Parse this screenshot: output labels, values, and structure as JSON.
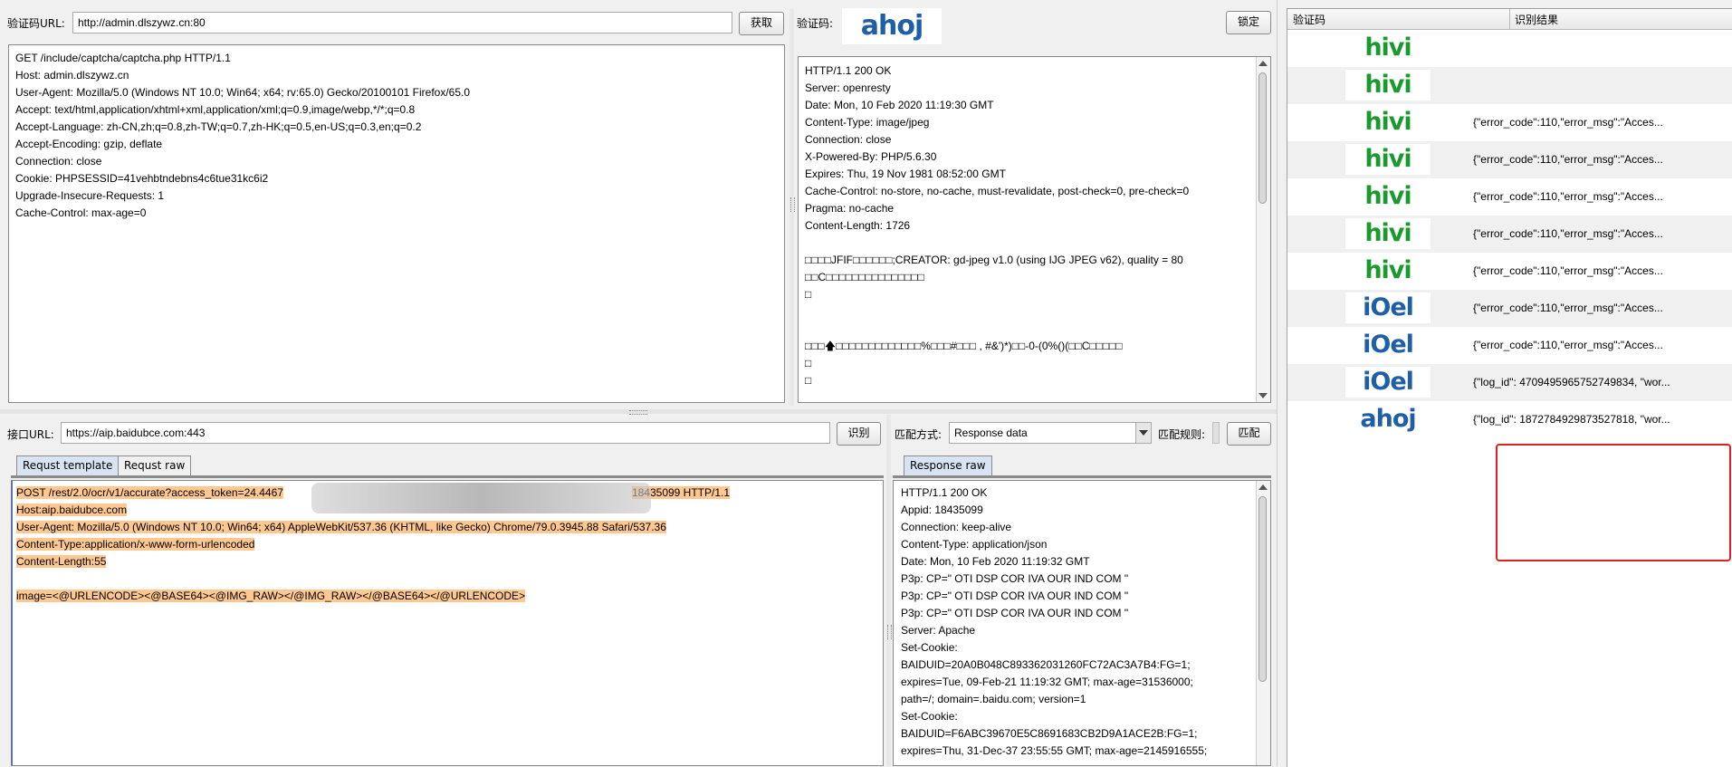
{
  "captcha_url": {
    "label": "验证码URL:",
    "value": "http://admin.dlszywz.cn:80",
    "fetch_button": "获取"
  },
  "captcha_preview": {
    "label": "验证码:",
    "image_text": "ahoj",
    "lock_button": "锁定"
  },
  "request_raw": [
    "GET /include/captcha/captcha.php HTTP/1.1",
    "Host: admin.dlszywz.cn",
    "User-Agent: Mozilla/5.0 (Windows NT 10.0; Win64; x64; rv:65.0) Gecko/20100101 Firefox/65.0",
    "Accept: text/html,application/xhtml+xml,application/xml;q=0.9,image/webp,*/*;q=0.8",
    "Accept-Language: zh-CN,zh;q=0.8,zh-TW;q=0.7,zh-HK;q=0.5,en-US;q=0.3,en;q=0.2",
    "Accept-Encoding: gzip, deflate",
    "Connection: close",
    "Cookie: PHPSESSID=41vehbtndebns4c6tue31kc6i2",
    "Upgrade-Insecure-Requests: 1",
    "Cache-Control: max-age=0"
  ],
  "response_raw": [
    "HTTP/1.1 200 OK",
    "Server: openresty",
    "Date: Mon, 10 Feb 2020 11:19:30 GMT",
    "Content-Type: image/jpeg",
    "Connection: close",
    "X-Powered-By: PHP/5.6.30",
    "Expires: Thu, 19 Nov 1981 08:52:00 GMT",
    "Cache-Control: no-store, no-cache, must-revalidate, post-check=0, pre-check=0",
    "Pragma: no-cache",
    "Content-Length: 1726",
    "",
    "□□□□JFIF□□□□□□;CREATOR: gd-jpeg v1.0 (using IJG JPEG v62), quality = 80",
    "□□C□□□□□□□□□□□□□□□",
    "□",
    "",
    "",
    "□□□🡅□□□□□□□□□□□□□%□□□#□□□ , #&')*)□□-0-(0%()(□□C□□□□□",
    "□",
    "□"
  ],
  "api_url": {
    "label": "接口URL:",
    "value": "https://aip.baidubce.com:443",
    "recognize_button": "识别"
  },
  "match": {
    "mode_label": "匹配方式:",
    "mode_value": "Response data",
    "rule_label": "匹配规则:",
    "match_button": "匹配"
  },
  "request_tabs": [
    "Requst template",
    "Requst raw"
  ],
  "request_template": [
    "POST /rest/2.0/ocr/v1/accurate?access_token=24.4467",
    "Host:aip.baidubce.com",
    "User-Agent: Mozilla/5.0 (Windows NT 10.0; Win64; x64) AppleWebKit/537.36 (KHTML, like Gecko) Chrome/79.0.3945.88 Safari/537.36",
    "Content-Type:application/x-www-form-urlencoded",
    "Content-Length:55",
    "",
    "image=<@URLENCODE><@BASE64><@IMG_RAW></@IMG_RAW></@BASE64></@URLENCODE>"
  ],
  "request_template_line1_tail": "18435099 HTTP/1.1",
  "response_tab": "Response raw",
  "api_response": [
    "HTTP/1.1 200 OK",
    "Appid: 18435099",
    "Connection: keep-alive",
    "Content-Type: application/json",
    "Date: Mon, 10 Feb 2020 11:19:32 GMT",
    "P3p: CP=\" OTI DSP COR IVA OUR IND COM \"",
    "P3p: CP=\" OTI DSP COR IVA OUR IND COM \"",
    "P3p: CP=\" OTI DSP COR IVA OUR IND COM \"",
    "Server: Apache",
    "Set-Cookie:",
    "BAIDUID=20A0B048C893362031260FC72AC3A7B4:FG=1;",
    "expires=Tue, 09-Feb-21 11:19:32 GMT; max-age=31536000;",
    "path=/; domain=.baidu.com; version=1",
    "Set-Cookie:",
    "BAIDUID=F6ABC39670E5C8691683CB2D9A1ACE2B:FG=1;",
    "expires=Thu, 31-Dec-37 23:55:55 GMT; max-age=2145916555;"
  ],
  "results": {
    "headers": [
      "验证码",
      "识别结果"
    ],
    "rows": [
      {
        "captcha": "hivi",
        "color": "#1a9a2e",
        "result": ""
      },
      {
        "captcha": "hivi",
        "color": "#1a9a2e",
        "result": ""
      },
      {
        "captcha": "hivi",
        "color": "#1a9a2e",
        "result": "{\"error_code\":110,\"error_msg\":\"Acces..."
      },
      {
        "captcha": "hivi",
        "color": "#1a9a2e",
        "result": "{\"error_code\":110,\"error_msg\":\"Acces..."
      },
      {
        "captcha": "hivi",
        "color": "#1a9a2e",
        "result": "{\"error_code\":110,\"error_msg\":\"Acces..."
      },
      {
        "captcha": "hivi",
        "color": "#1a9a2e",
        "result": "{\"error_code\":110,\"error_msg\":\"Acces..."
      },
      {
        "captcha": "hivi",
        "color": "#1a9a2e",
        "result": "{\"error_code\":110,\"error_msg\":\"Acces..."
      },
      {
        "captcha": "iOel",
        "color": "#1e5fa8",
        "result": "{\"error_code\":110,\"error_msg\":\"Acces..."
      },
      {
        "captcha": "iOel",
        "color": "#1e5fa8",
        "result": "{\"error_code\":110,\"error_msg\":\"Acces..."
      },
      {
        "captcha": "iOel",
        "color": "#1e5fa8",
        "result": "{\"log_id\": 4709495965752749834, \"wor..."
      },
      {
        "captcha": "ahoj",
        "color": "#1e5fa8",
        "result": "{\"log_id\": 1872784929873527818, \"wor..."
      }
    ]
  },
  "colors": {
    "highlight": "#ffc891",
    "callout_border": "#e02020",
    "active_tab": "#d9e4f2",
    "stripe": "#f0f0f0"
  }
}
